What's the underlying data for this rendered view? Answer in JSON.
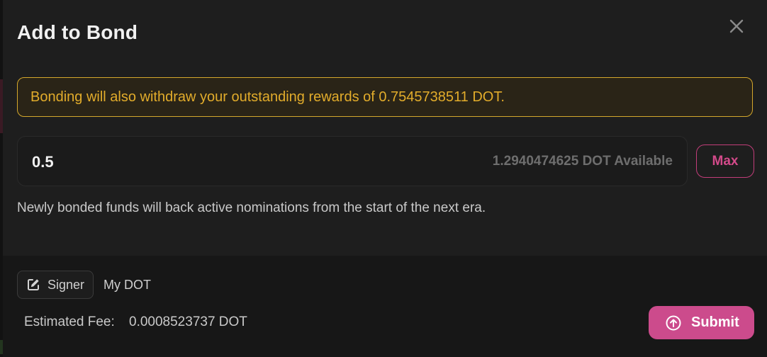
{
  "modal": {
    "title": "Add to Bond",
    "close_icon": "close-icon"
  },
  "warning": {
    "text": "Bonding will also withdraw your outstanding rewards of 0.7545738511 DOT."
  },
  "bond_input": {
    "value": "0.5",
    "available": "1.2940474625 DOT Available",
    "max_label": "Max"
  },
  "note": {
    "text": "Newly bonded funds will back active nominations from the start of the next era."
  },
  "footer": {
    "signer_label": "Signer",
    "signer_icon": "edit-icon",
    "account": "My DOT",
    "fee_label": "Estimated Fee:",
    "fee_value": "0.0008523737 DOT",
    "submit_label": "Submit",
    "submit_icon": "arrow-up-circle-icon"
  },
  "colors": {
    "accent": "#cc4b8c",
    "warning": "#e2ac2b"
  }
}
